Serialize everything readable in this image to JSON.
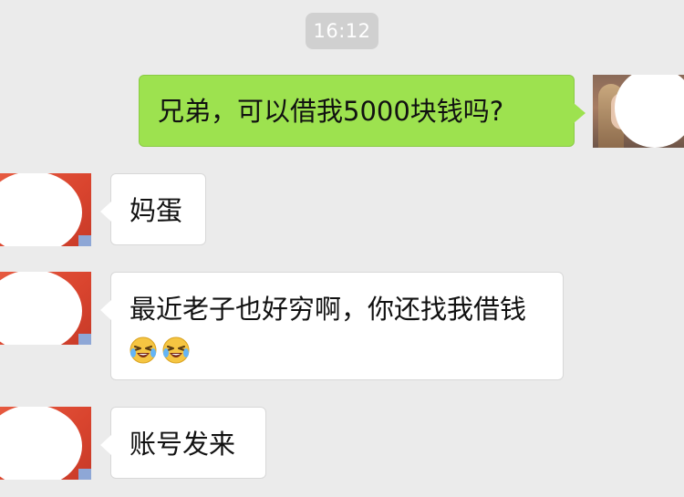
{
  "timestamp": "16:12",
  "messages": [
    {
      "sender": "self",
      "text": "兄弟，可以借我5000块钱吗?"
    },
    {
      "sender": "friend",
      "text": "妈蛋"
    },
    {
      "sender": "friend",
      "text": "最近老子也好穷啊，你还找我借钱",
      "emojis": [
        "laughing-crying-emoji",
        "laughing-crying-emoji"
      ]
    },
    {
      "sender": "friend",
      "text": "账号发来"
    }
  ],
  "colors": {
    "background": "#ebebeb",
    "self_bubble": "#9de24f",
    "friend_bubble": "#ffffff",
    "time_pill": "#d0d0d0",
    "friend_avatar": "#e65a40"
  },
  "icons": {
    "emoji": "laughing-crying-emoji"
  }
}
